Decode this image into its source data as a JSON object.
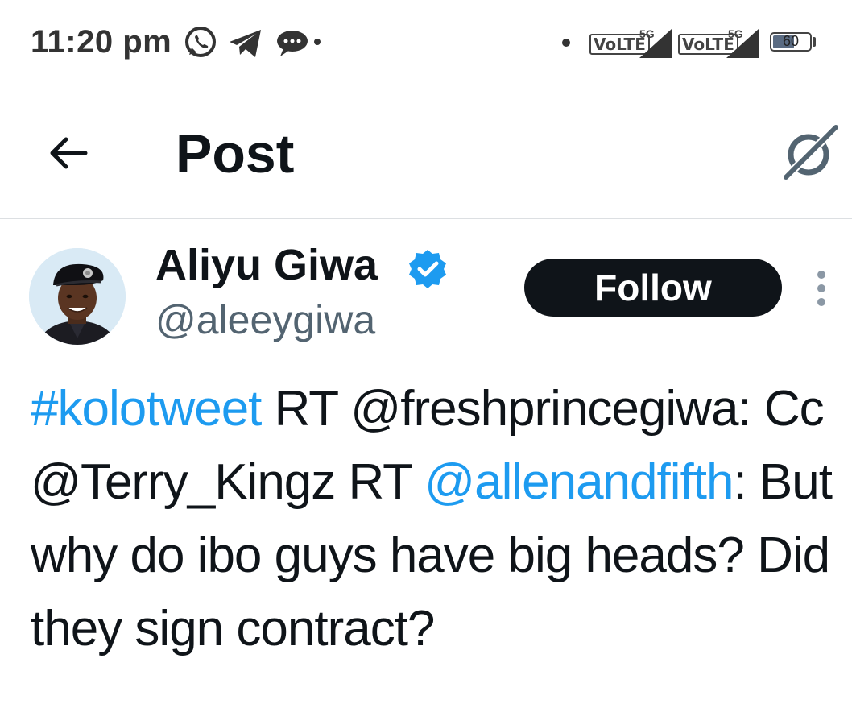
{
  "status_bar": {
    "time": "11:20 pm",
    "icons": [
      "whatsapp-icon",
      "telegram-icon",
      "chat-bubble-icon",
      "notification-dot"
    ],
    "sim1": {
      "volte": "VoLTE",
      "network": "5G"
    },
    "sim2": {
      "volte": "VoLTE",
      "network": "5G"
    },
    "battery_level": "60",
    "battery_fraction": 0.6
  },
  "header": {
    "title": "Post",
    "back_icon": "arrow-left-icon",
    "grok_icon": "grok-icon"
  },
  "post": {
    "author": {
      "display_name": "Aliyu Giwa",
      "handle": "@aleeygiwa",
      "verified": true
    },
    "follow_label": "Follow",
    "text_parts": {
      "hashtag": "#kolotweet",
      "part1": " RT @freshprincegiwa: Cc @Terry_Kingz RT ",
      "mention": "@allenandfifth",
      "part2": ": But why do ibo guys have big heads? Did they sign contract?"
    }
  },
  "colors": {
    "link": "#1d9bf0",
    "text": "#0f1419",
    "secondary": "#536471",
    "button": "#0f1419"
  }
}
